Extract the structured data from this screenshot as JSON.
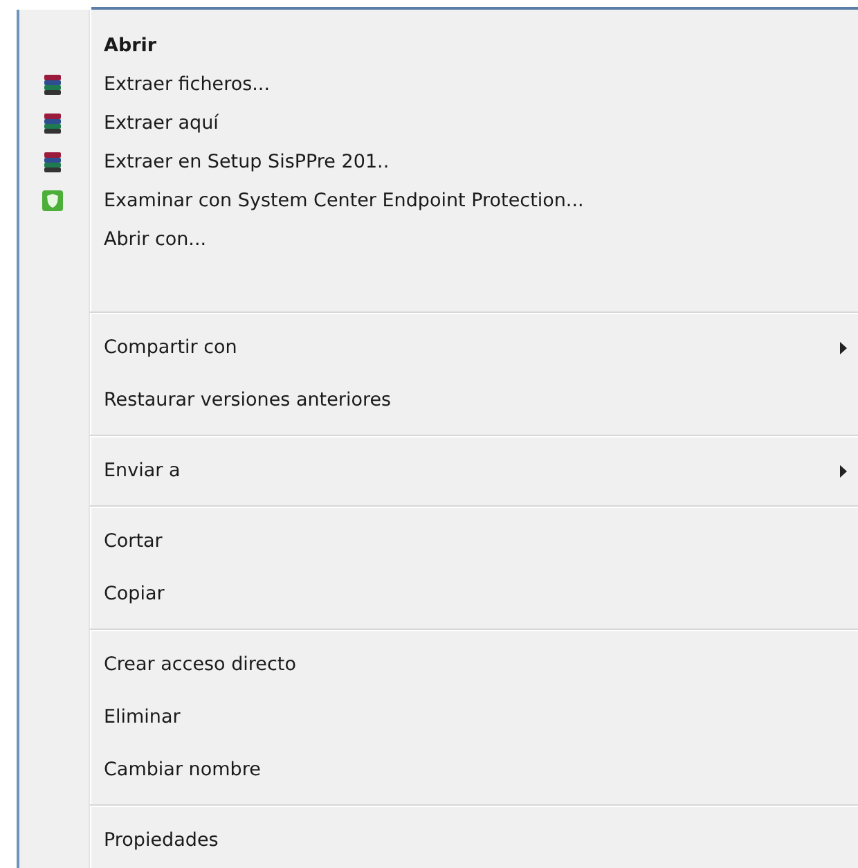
{
  "context_menu": {
    "groups": [
      {
        "items": [
          {
            "label": "Abrir",
            "default": true,
            "kind": "plain",
            "submenu": false
          },
          {
            "label": "Extraer ficheros...",
            "default": false,
            "kind": "archive",
            "submenu": false
          },
          {
            "label": "Extraer aquí",
            "default": false,
            "kind": "archive",
            "submenu": false
          },
          {
            "label": "Extraer en Setup SisPPre 201..",
            "default": false,
            "kind": "archive",
            "submenu": false
          },
          {
            "label": "Examinar con System Center Endpoint Protection...",
            "default": false,
            "kind": "shield",
            "submenu": false
          },
          {
            "label": "Abrir con...",
            "default": false,
            "kind": "plain",
            "submenu": false
          }
        ]
      },
      {
        "items": [
          {
            "label": "Compartir con",
            "default": false,
            "kind": "plain",
            "submenu": true
          },
          {
            "label": "Restaurar versiones anteriores",
            "default": false,
            "kind": "plain",
            "submenu": false
          }
        ]
      },
      {
        "items": [
          {
            "label": "Enviar a",
            "default": false,
            "kind": "plain",
            "submenu": true
          }
        ]
      },
      {
        "items": [
          {
            "label": "Cortar",
            "default": false,
            "kind": "plain",
            "submenu": false
          },
          {
            "label": "Copiar",
            "default": false,
            "kind": "plain",
            "submenu": false
          }
        ]
      },
      {
        "items": [
          {
            "label": "Crear acceso directo",
            "default": false,
            "kind": "plain",
            "submenu": false
          },
          {
            "label": "Eliminar",
            "default": false,
            "kind": "plain",
            "submenu": false
          },
          {
            "label": "Cambiar nombre",
            "default": false,
            "kind": "plain",
            "submenu": false
          }
        ]
      },
      {
        "items": [
          {
            "label": "Propiedades",
            "default": false,
            "kind": "plain",
            "submenu": false
          }
        ]
      }
    ]
  }
}
